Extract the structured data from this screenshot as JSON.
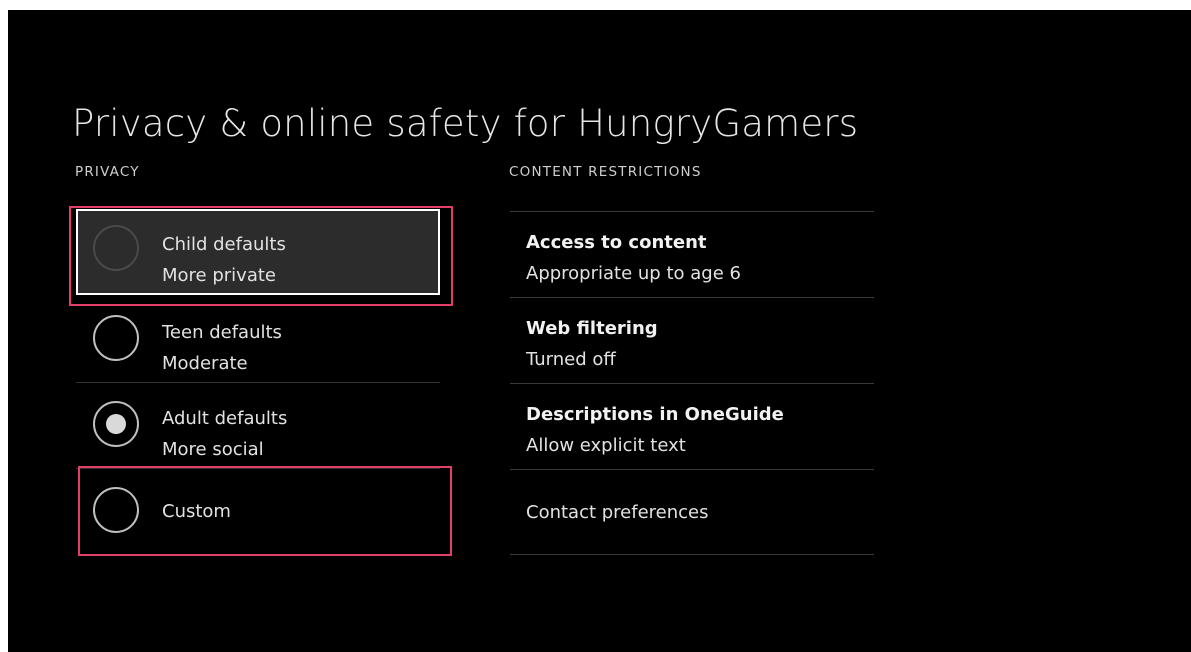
{
  "page": {
    "title": "Privacy & online safety for HungryGamers"
  },
  "privacy": {
    "header": "PRIVACY",
    "options": [
      {
        "label": "Child defaults",
        "sublabel": "More private",
        "selected": false,
        "focused": true
      },
      {
        "label": "Teen defaults",
        "sublabel": "Moderate",
        "selected": false,
        "focused": false
      },
      {
        "label": "Adult defaults",
        "sublabel": "More social",
        "selected": true,
        "focused": false
      },
      {
        "label": "Custom",
        "sublabel": "",
        "selected": false,
        "focused": false
      }
    ]
  },
  "content_restrictions": {
    "header": "CONTENT RESTRICTIONS",
    "items": [
      {
        "title": "Access to content",
        "value": "Appropriate up to age 6"
      },
      {
        "title": "Web filtering",
        "value": "Turned off"
      },
      {
        "title": "Descriptions in OneGuide",
        "value": "Allow explicit text"
      },
      {
        "label": "Contact preferences"
      }
    ]
  },
  "colors": {
    "background": "#000000",
    "focus_fill": "#2c2c2c",
    "annotation_highlight": "#e33e67"
  }
}
